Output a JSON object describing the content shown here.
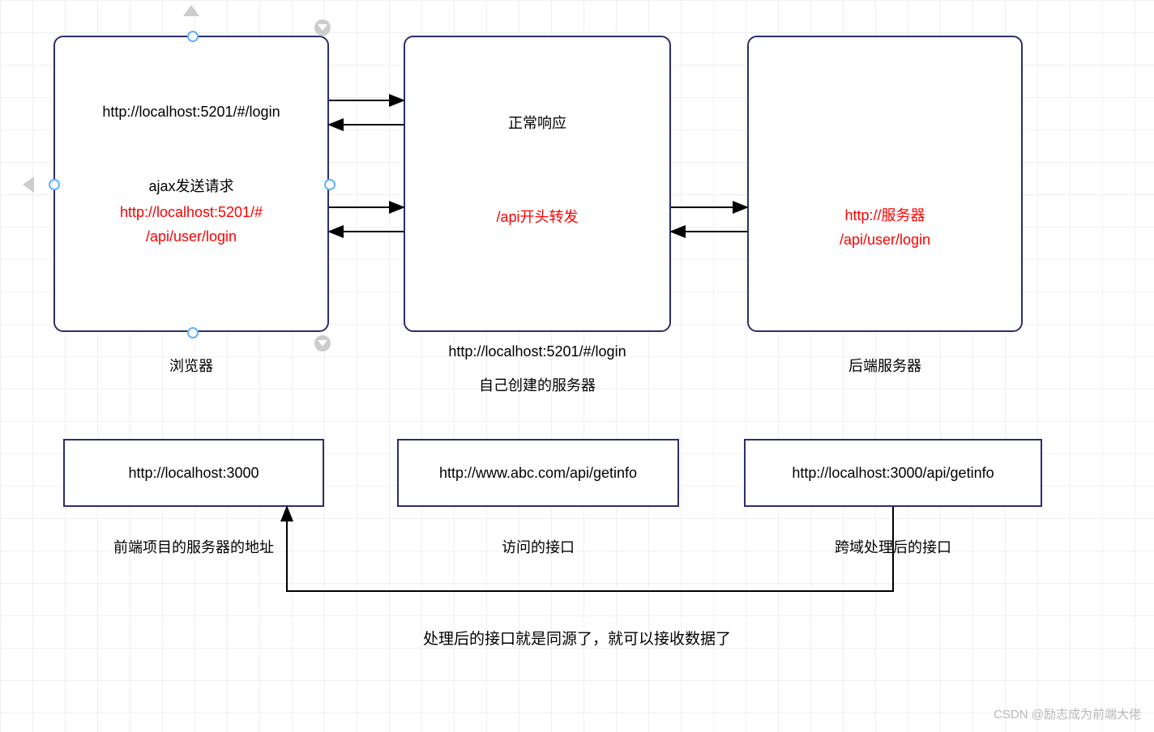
{
  "diagram": {
    "box_browser": {
      "url_line": "http://localhost:5201/#/login",
      "ajax_label": "ajax发送请求",
      "ajax_url_line1": "http://localhost:5201/#",
      "ajax_url_line2": "/api/user/login"
    },
    "box_proxy": {
      "normal_response": "正常响应",
      "api_forward": "/api开头转发"
    },
    "box_backend": {
      "server_line1": "http://服务器",
      "server_line2": "/api/user/login"
    },
    "labels": {
      "browser": "浏览器",
      "proxy_url": "http://localhost:5201/#/login",
      "proxy_desc": "自己创建的服务器",
      "backend": "后端服务器"
    },
    "row2": {
      "frontend_server": "http://localhost:3000",
      "frontend_server_label": "前端项目的服务器的地址",
      "api_access": "http://www.abc.com/api/getinfo",
      "api_access_label": "访问的接口",
      "cross_origin": "http://localhost:3000/api/getinfo",
      "cross_origin_label": "跨域处理后的接口"
    },
    "conclusion": "处理后的接口就是同源了，就可以接收数据了"
  },
  "watermark": "CSDN @励志成为前端大佬"
}
